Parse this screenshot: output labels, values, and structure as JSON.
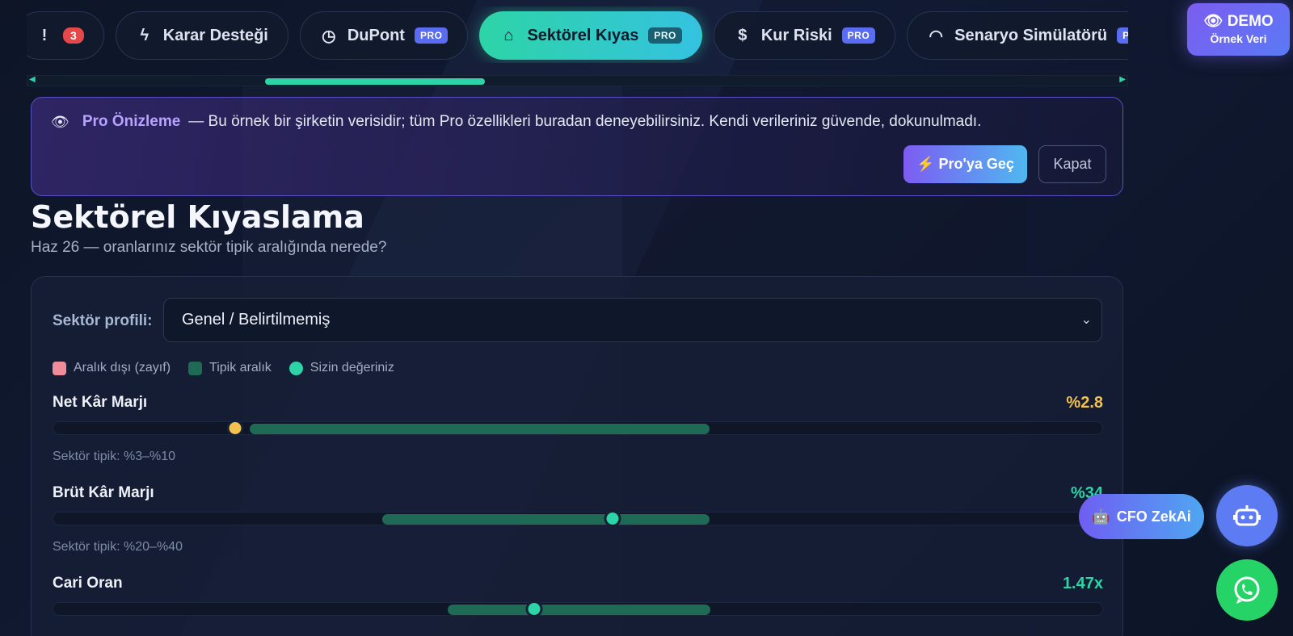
{
  "tabs": [
    {
      "label": "",
      "icon": "alert-icon",
      "badge": "3",
      "pro": false,
      "active": false
    },
    {
      "label": "Karar Desteği",
      "icon": "bolt-icon",
      "pro": false,
      "active": false
    },
    {
      "label": "DuPont",
      "icon": "clock-icon",
      "pro": true,
      "active": false
    },
    {
      "label": "Sektörel Kıyas",
      "icon": "bank-icon",
      "pro": true,
      "active": true
    },
    {
      "label": "Kur Riski",
      "icon": "dollar-icon",
      "pro": true,
      "active": false
    },
    {
      "label": "Senaryo Simülatörü",
      "icon": "gauge-icon",
      "pro": true,
      "active": false
    }
  ],
  "pro_label": "PRO",
  "demo": {
    "title": "DEMO",
    "subtitle": "Örnek Veri"
  },
  "banner": {
    "title": "Pro Önizleme",
    "message": "— Bu örnek bir şirketin verisidir; tüm Pro özellikleri buradan deneyebilirsiniz. Kendi verileriniz güvende, dokunulmadı.",
    "upgrade_label": "Pro'ya Geç",
    "close_label": "Kapat"
  },
  "page": {
    "title": "Sektörel Kıyaslama",
    "subtitle": "Haz 26 — oranlarınız sektör tipik aralığında nerede?"
  },
  "sector": {
    "label": "Sektör profili:",
    "selected": "Genel / Belirtilmemiş"
  },
  "legend": [
    {
      "label": "Aralık dışı (zayıf)",
      "color": "#f08c9a",
      "shape": "square"
    },
    {
      "label": "Tipik aralık",
      "color": "#1e6a55",
      "shape": "square"
    },
    {
      "label": "Sizin değeriniz",
      "color": "#2dd4a7",
      "shape": "circle"
    }
  ],
  "metrics": [
    {
      "name": "Net Kâr Marjı",
      "value": "%2.8",
      "value_color": "#f2c14e",
      "typical": "Sektör tipik: %3–%10",
      "range_start": 0.187,
      "range_end": 0.625,
      "marker": 0.173,
      "marker_color": "#f2c14e"
    },
    {
      "name": "Brüt Kâr Marjı",
      "value": "%34",
      "value_color": "#2dd4a7",
      "typical": "Sektör tipik: %20–%40",
      "range_start": 0.313,
      "range_end": 0.625,
      "marker": 0.532,
      "marker_color": "#2dd4a7"
    },
    {
      "name": "Cari Oran",
      "value": "1.47x",
      "value_color": "#2dd4a7",
      "typical": "",
      "range_start": 0.375,
      "range_end": 0.625,
      "marker": 0.458,
      "marker_color": "#2dd4a7"
    }
  ],
  "floating": {
    "cfo_label": "CFO ZekAi"
  },
  "colors": {
    "accent": "#2dd4a7",
    "pro_badge": "#5a6cf0",
    "banner_border": "#5b4fc6"
  }
}
